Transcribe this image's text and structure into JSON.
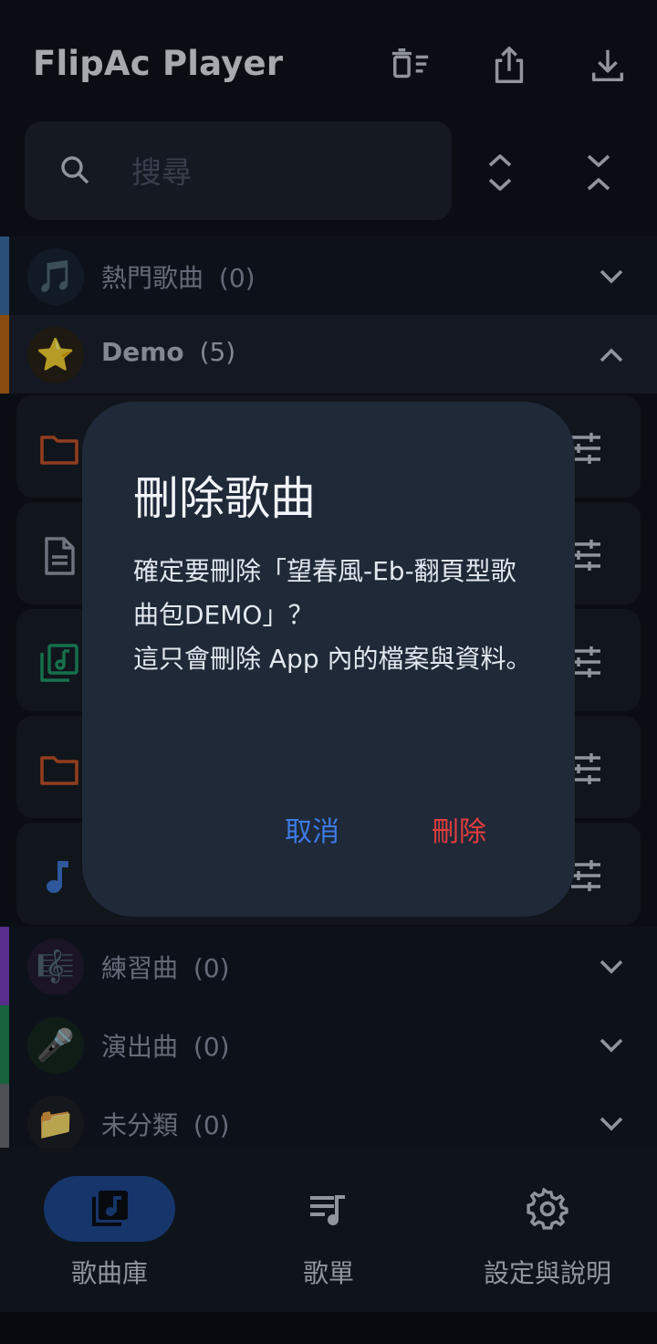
{
  "app": {
    "title": "FlipAc Player",
    "actions": [
      "delete-list-icon",
      "share-icon",
      "download-icon"
    ]
  },
  "search": {
    "placeholder": "搜尋"
  },
  "categories": [
    {
      "emoji": "🎵",
      "name": "熱門歌曲",
      "count": "(0)",
      "accent": "#3b6ea8",
      "expanded": false
    },
    {
      "emoji": "⭐",
      "name": "Demo",
      "count": "(5)",
      "accent": "#c06a14",
      "expanded": true
    },
    {
      "emoji": "🎼",
      "name": "練習曲",
      "count": "(0)",
      "accent": "#7a3fc2",
      "expanded": false
    },
    {
      "emoji": "🎤",
      "name": "演出曲",
      "count": "(0)",
      "accent": "#1f8a57",
      "expanded": false
    },
    {
      "emoji": "📁",
      "name": "未分類",
      "count": "(0)",
      "accent": "#6b6f76",
      "expanded": false
    }
  ],
  "demo_items": [
    {
      "icon": "folder-icon",
      "color": "#c9552a"
    },
    {
      "icon": "document-icon",
      "color": "#9aa3b0"
    },
    {
      "icon": "music-library-icon",
      "color": "#1f9d68"
    },
    {
      "icon": "folder-icon",
      "color": "#c9552a"
    },
    {
      "icon": "music-note-icon",
      "color": "#3f7ad8"
    }
  ],
  "dialog": {
    "title": "刪除歌曲",
    "message_line1": "確定要刪除「望春風-Eb-翻頁型歌曲包DEMO」？",
    "message_line2": "這只會刪除 App 內的檔案與資料。",
    "cancel": "取消",
    "confirm": "刪除"
  },
  "bottom_nav": [
    {
      "label": "歌曲庫",
      "icon": "library-music-icon",
      "active": true
    },
    {
      "label": "歌單",
      "icon": "playlist-icon",
      "active": false
    },
    {
      "label": "設定與說明",
      "icon": "settings-gear-icon",
      "active": false
    }
  ],
  "colors": {
    "background": "#0f141c",
    "dialog": "#1f2938",
    "accent_blue": "#3d7be6",
    "danger": "#e33d3d",
    "nav_active": "#1f4a93"
  }
}
